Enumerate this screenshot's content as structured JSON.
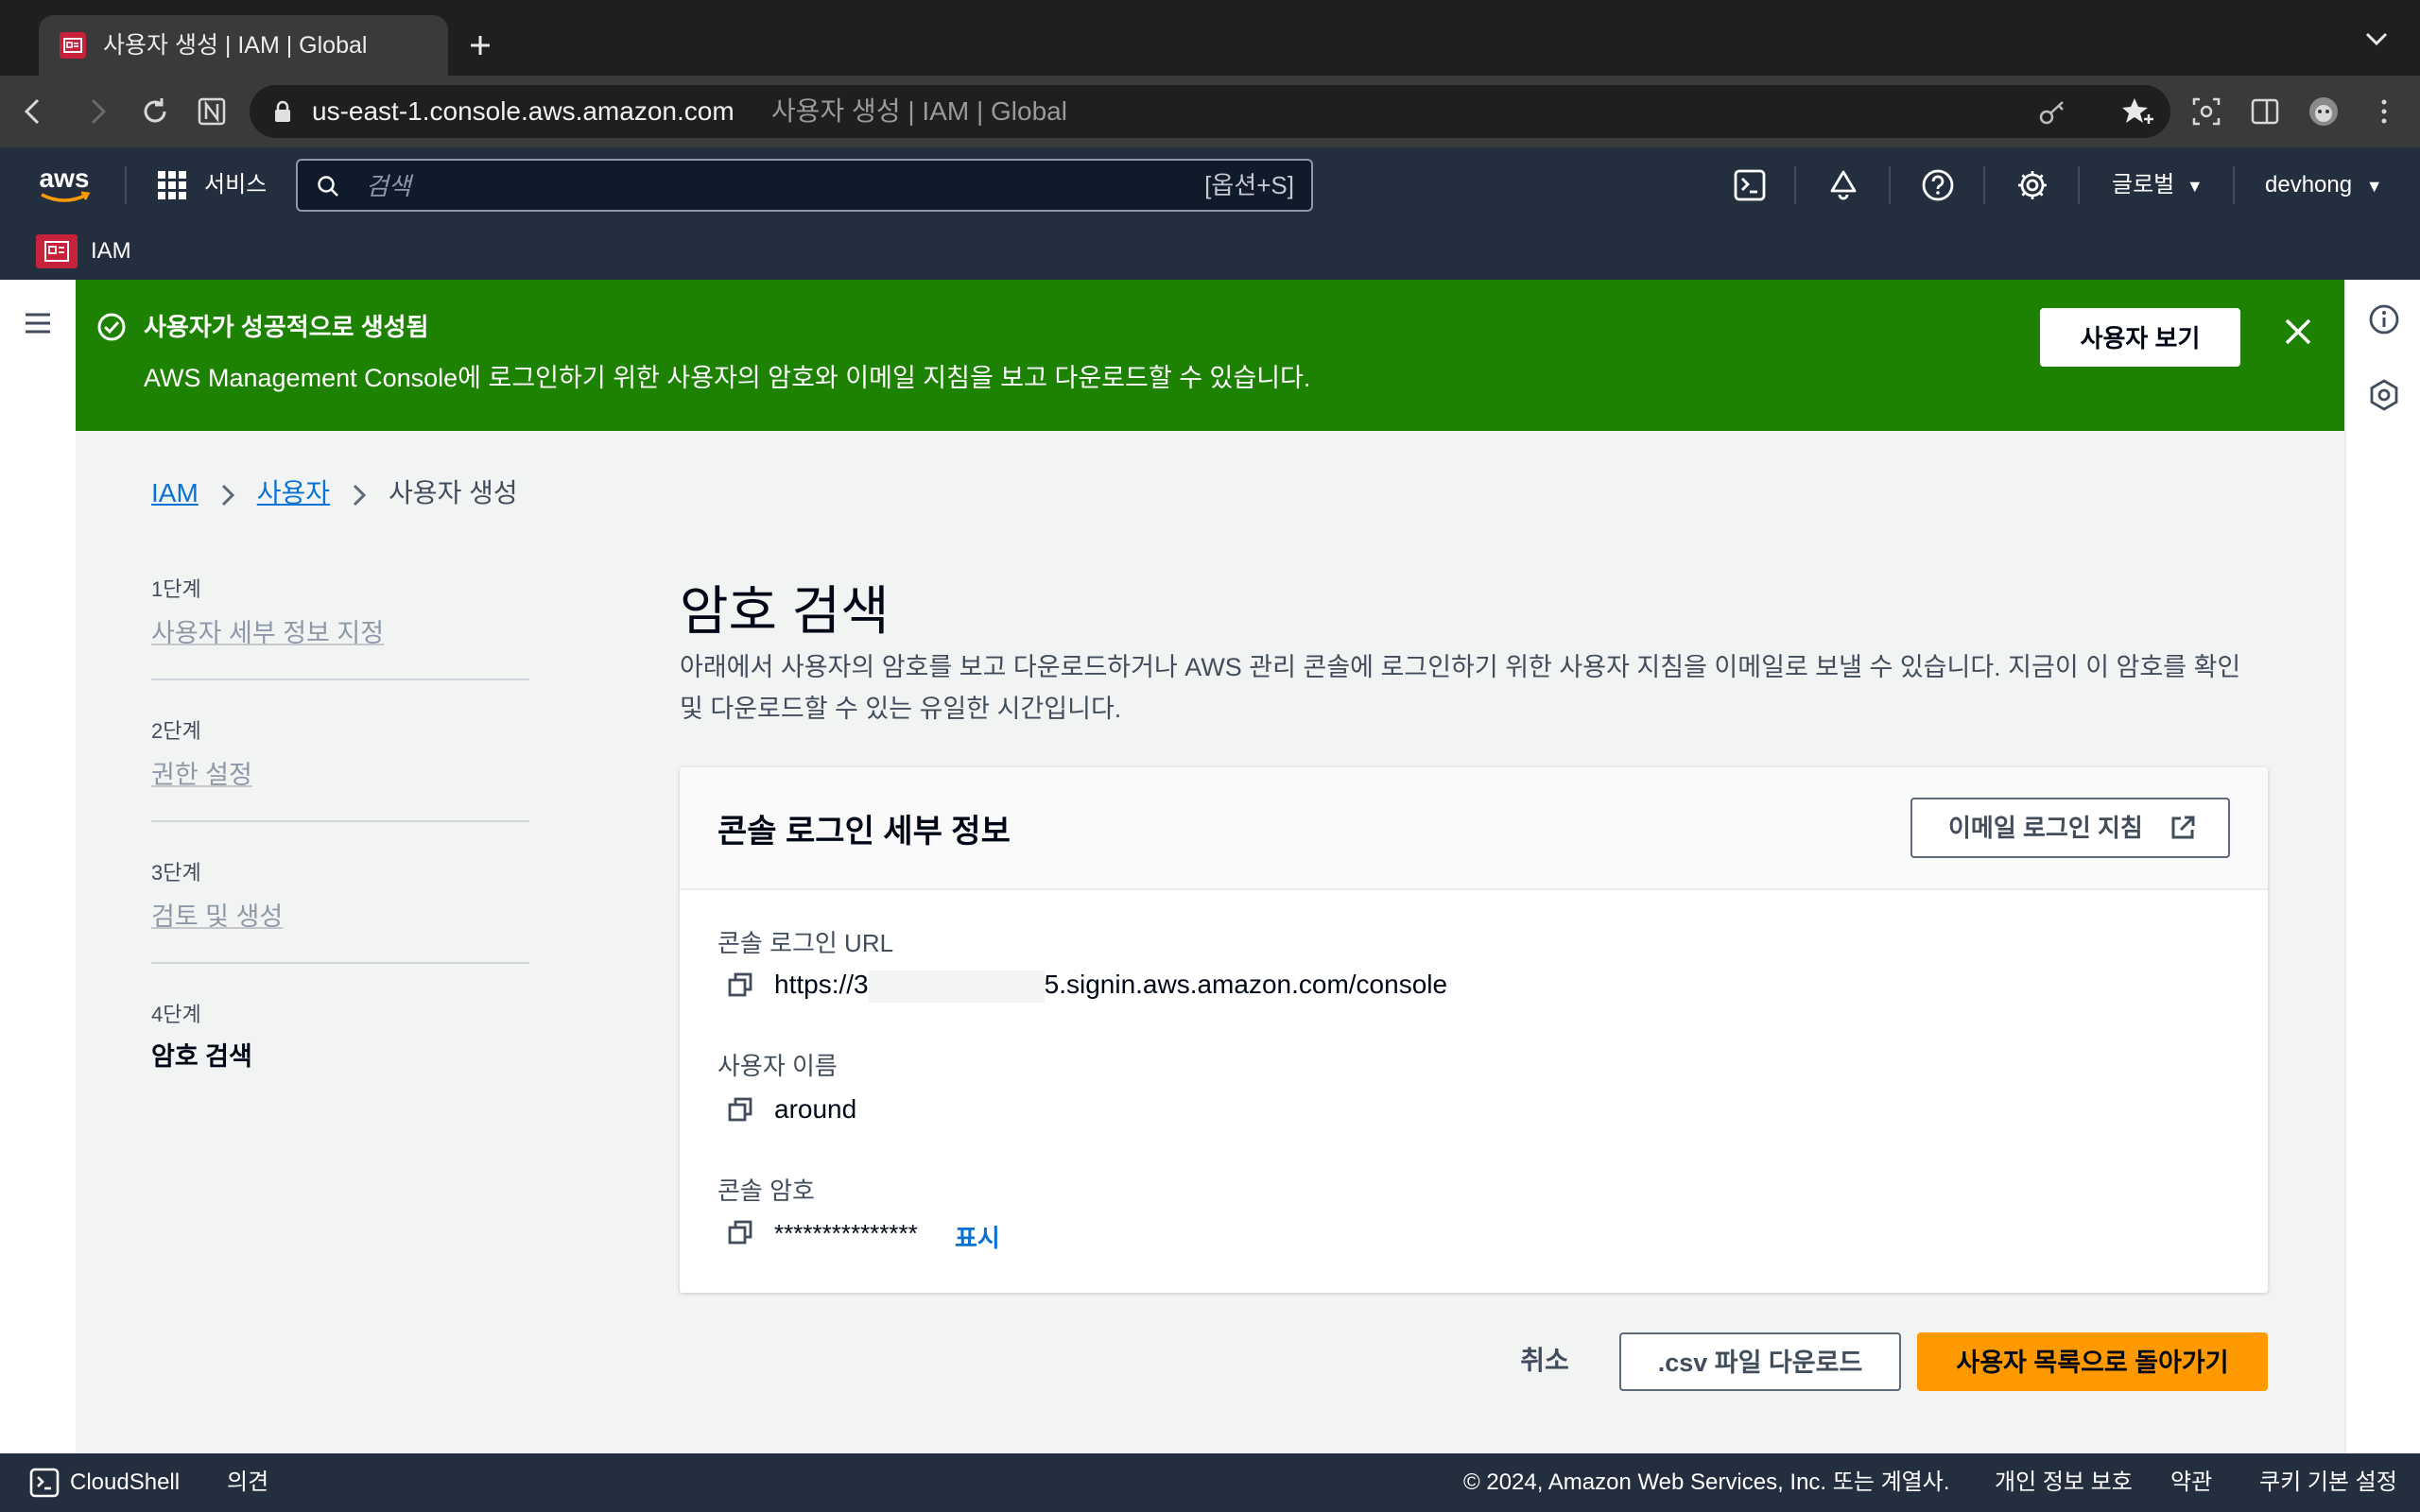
{
  "browser": {
    "tab_title": "사용자 생성 | IAM | Global",
    "url_host": "us-east-1.console.aws.amazon.com",
    "url_page_title": "사용자 생성 | IAM | Global"
  },
  "aws_header": {
    "logo_text": "aws",
    "services_label": "서비스",
    "search_placeholder": "검색",
    "search_shortcut": "[옵션+S]",
    "region_label": "글로벌",
    "user_label": "devhong",
    "service_label": "IAM"
  },
  "flash": {
    "title": "사용자가 성공적으로 생성됨",
    "message": "AWS Management Console에 로그인하기 위한 사용자의 암호와 이메일 지침을 보고 다운로드할 수 있습니다.",
    "view_user_button": "사용자 보기"
  },
  "breadcrumb": {
    "items": [
      "IAM",
      "사용자",
      "사용자 생성"
    ]
  },
  "steps": [
    {
      "number": "1단계",
      "label": "사용자 세부 정보 지정"
    },
    {
      "number": "2단계",
      "label": "권한 설정"
    },
    {
      "number": "3단계",
      "label": "검토 및 생성"
    },
    {
      "number": "4단계",
      "label": "암호 검색"
    }
  ],
  "main": {
    "title": "암호 검색",
    "description": "아래에서 사용자의 암호를 보고 다운로드하거나 AWS 관리 콘솔에 로그인하기 위한 사용자 지침을 이메일로 보낼 수 있습니다. 지금이 이 암호를 확인 및 다운로드할 수 있는 유일한 시간입니다."
  },
  "details": {
    "title": "콘솔 로그인 세부 정보",
    "email_button": "이메일 로그인 지침",
    "url_label": "콘솔 로그인 URL",
    "url_prefix": "https://3",
    "url_suffix": "5.signin.aws.amazon.com/console",
    "username_label": "사용자 이름",
    "username_value": "around",
    "password_label": "콘솔 암호",
    "password_value": "***************",
    "show_link": "표시"
  },
  "actions": {
    "cancel": "취소",
    "download_csv": ".csv 파일 다운로드",
    "return": "사용자 목록으로 돌아가기"
  },
  "footer": {
    "cloudshell": "CloudShell",
    "feedback": "의견",
    "copyright": "© 2024, Amazon Web Services, Inc. 또는 계열사.",
    "privacy": "개인 정보 보호",
    "terms": "약관",
    "cookies": "쿠키 기본 설정"
  },
  "colors": {
    "success_green": "#1d8102",
    "primary_orange": "#ff9900",
    "link_blue": "#0972d3",
    "nav_dark": "#232f3e"
  }
}
